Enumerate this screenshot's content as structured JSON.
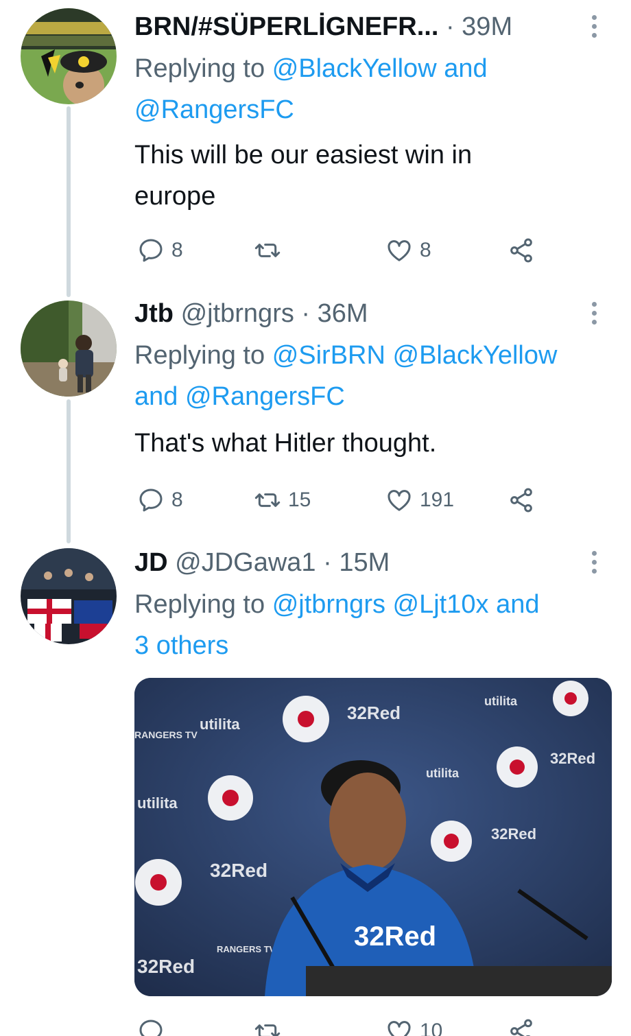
{
  "tweets": [
    {
      "display_name": "BRN/#SÜPERLİGNEFR...",
      "handle": "",
      "time": "39M",
      "replying_prefix": "Replying to",
      "replying_line1": "@BlackYellow and",
      "replying_line2": "@RangersFC",
      "text_line1": "This will be our easiest win in",
      "text_line2": "europe",
      "replies": "8",
      "retweets": "",
      "likes": "8"
    },
    {
      "display_name": "Jtb",
      "handle": "@jtbrngrs",
      "time": "36M",
      "replying_prefix": "Replying to",
      "replying_line1": "@SirBRN @BlackYellow",
      "replying_line2": "and @RangersFC",
      "text_line1": "That's what Hitler thought.",
      "replies": "8",
      "retweets": "15",
      "likes": "191"
    },
    {
      "display_name": "JD",
      "handle": "@JDGawa1",
      "time": "15M",
      "replying_prefix": "Replying to",
      "replying_line1": "@jtbrngrs @Ljt10x and",
      "replying_line2": "3 others",
      "media_alt": "Rangers press conference photo",
      "likes": "10"
    }
  ],
  "media_text": {
    "sponsor": "32Red",
    "utility": "utilita",
    "tv": "RANGERS TV"
  },
  "icons": {
    "reply": "reply-icon",
    "retweet": "retweet-icon",
    "like": "like-icon",
    "share": "share-icon",
    "more": "more-icon"
  },
  "colors": {
    "mention": "#1d9bf0",
    "secondary_text": "#536471",
    "thread_line": "#cfd9de"
  }
}
